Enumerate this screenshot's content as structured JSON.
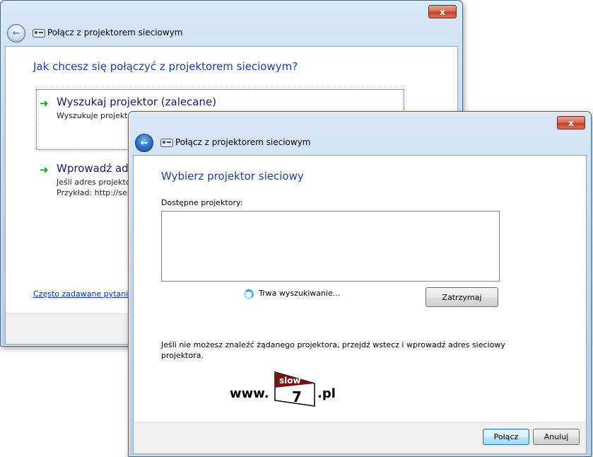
{
  "back_window": {
    "nav_title": "Połącz z projektorem sieciowym",
    "heading": "Jak chcesz się połączyć z projektorem sieciowym?",
    "option_search": {
      "title": "Wyszukaj projektor (zalecane)",
      "desc": "Wyszukuje projekto"
    },
    "option_enter": {
      "title": "Wprowadź adr",
      "desc_line1": "Jeśli adres projektor",
      "desc_line2": "Przykład: http://serv"
    },
    "faq_link": "Często zadawane pytania",
    "close_label": "x"
  },
  "front_window": {
    "nav_title": "Połącz z projektorem sieciowym",
    "heading": "Wybierz projektor sieciowy",
    "list_label": "Dostępne projektory:",
    "searching_status": "Trwa wyszukiwanie...",
    "stop_button": "Zatrzymaj",
    "help_text_line1": "Jeśli nie możesz znaleźć żądanego projektora, przejdź wstecz i wprowadź adres sieciowy",
    "help_text_line2": "projektora.",
    "connect_button": "Połącz",
    "cancel_button": "Anuluj",
    "close_label": "x"
  },
  "watermark": {
    "prefix": "www.",
    "flag_text": "slow",
    "number": "7",
    "suffix": ".pl"
  },
  "colors": {
    "heading": "#1e3f94",
    "command_arrow": "#1a9a2a",
    "link": "#0033cc",
    "close_button": "#c0412a"
  }
}
